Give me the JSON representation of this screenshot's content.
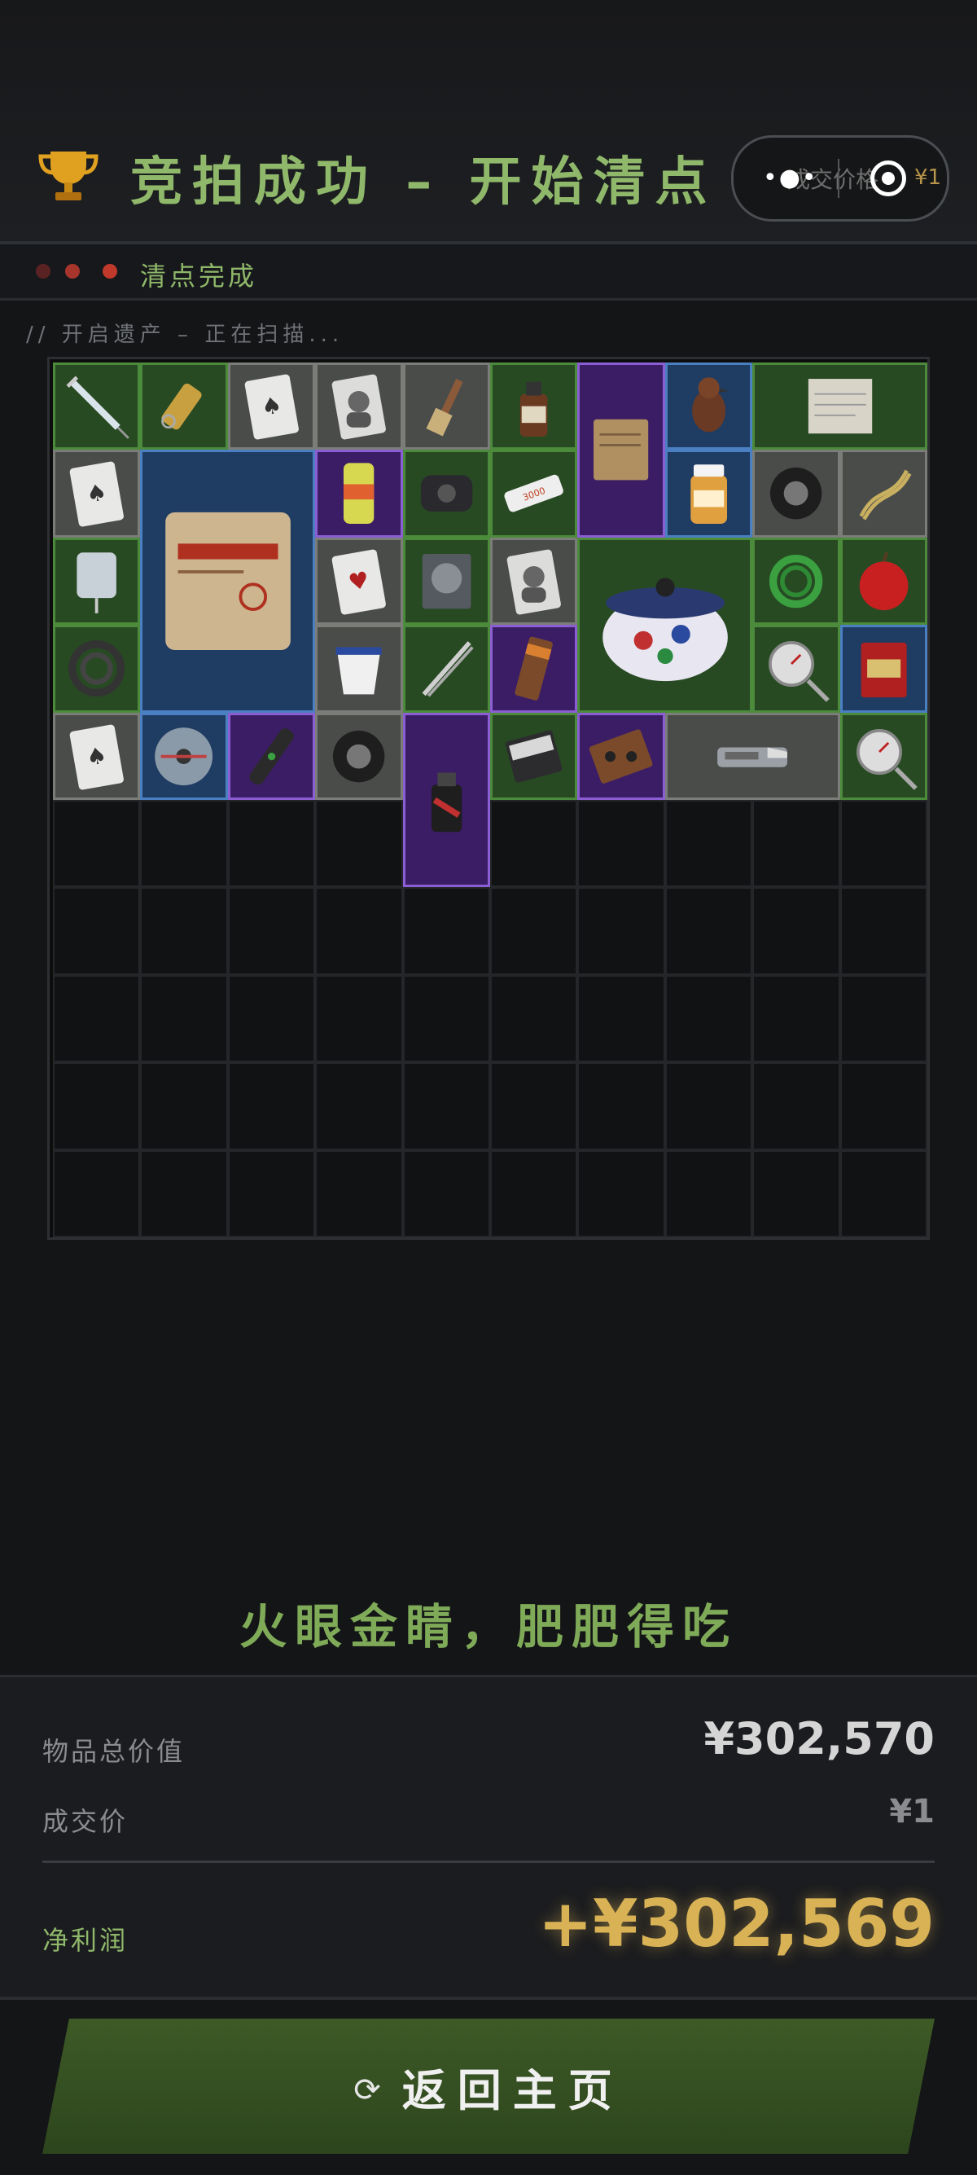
{
  "header": {
    "title": "竞拍成功 – 开始清点",
    "capsule": {
      "ghost_text": "成交价格",
      "ghost_price": "¥1"
    }
  },
  "status": {
    "text": "清点完成",
    "led_colors": [
      "#5a2222",
      "#a8352c",
      "#c0392b"
    ]
  },
  "scan_text": "// 开启遗产 – 正在扫描...",
  "grid": {
    "cols": 10,
    "rows": 10
  },
  "items": [
    {
      "name": "syringe-item",
      "rarity": "green",
      "c": 0,
      "r": 0,
      "w": 1,
      "h": 1,
      "icon": "syringe"
    },
    {
      "name": "bullet-keychain-item",
      "rarity": "green",
      "c": 1,
      "r": 0,
      "w": 1,
      "h": 1,
      "icon": "bullet"
    },
    {
      "name": "playing-card-item",
      "rarity": "gray",
      "c": 2,
      "r": 0,
      "w": 1,
      "h": 1,
      "icon": "card"
    },
    {
      "name": "portrait-card-item",
      "rarity": "gray",
      "c": 3,
      "r": 0,
      "w": 1,
      "h": 1,
      "icon": "portrait"
    },
    {
      "name": "brush-item",
      "rarity": "gray",
      "c": 4,
      "r": 0,
      "w": 1,
      "h": 1,
      "icon": "brush"
    },
    {
      "name": "medicine-bottle-item",
      "rarity": "green",
      "c": 5,
      "r": 0,
      "w": 1,
      "h": 1,
      "icon": "bottle"
    },
    {
      "name": "old-documents-item",
      "rarity": "purple",
      "c": 6,
      "r": 0,
      "w": 1,
      "h": 2,
      "icon": "docs"
    },
    {
      "name": "bird-figurine-item",
      "rarity": "blue",
      "c": 7,
      "r": 0,
      "w": 1,
      "h": 1,
      "icon": "bird"
    },
    {
      "name": "letter-item",
      "rarity": "green",
      "c": 8,
      "r": 0,
      "w": 2,
      "h": 1,
      "icon": "letter"
    },
    {
      "name": "card-spades-item",
      "rarity": "gray",
      "c": 0,
      "r": 1,
      "w": 1,
      "h": 1,
      "icon": "card"
    },
    {
      "name": "cement-bag-item",
      "rarity": "blue",
      "c": 1,
      "r": 1,
      "w": 2,
      "h": 3,
      "icon": "cement"
    },
    {
      "name": "energy-drink-item",
      "rarity": "purple",
      "c": 3,
      "r": 1,
      "w": 1,
      "h": 1,
      "icon": "can"
    },
    {
      "name": "power-bank-item",
      "rarity": "green",
      "c": 4,
      "r": 1,
      "w": 1,
      "h": 1,
      "icon": "device"
    },
    {
      "name": "battery-item",
      "rarity": "green",
      "c": 5,
      "r": 1,
      "w": 1,
      "h": 1,
      "icon": "battery"
    },
    {
      "name": "vitamin-bottle-item",
      "rarity": "blue",
      "c": 7,
      "r": 1,
      "w": 1,
      "h": 1,
      "icon": "pills"
    },
    {
      "name": "duct-tape-item",
      "rarity": "gray",
      "c": 8,
      "r": 1,
      "w": 1,
      "h": 1,
      "icon": "tape"
    },
    {
      "name": "rope-item",
      "rarity": "gray",
      "c": 9,
      "r": 1,
      "w": 1,
      "h": 1,
      "icon": "rope"
    },
    {
      "name": "iv-bag-item",
      "rarity": "green",
      "c": 0,
      "r": 2,
      "w": 1,
      "h": 1,
      "icon": "ivbag"
    },
    {
      "name": "card-hearts-item",
      "rarity": "gray",
      "c": 3,
      "r": 2,
      "w": 1,
      "h": 1,
      "icon": "cardred"
    },
    {
      "name": "hard-drive-item",
      "rarity": "green",
      "c": 4,
      "r": 2,
      "w": 1,
      "h": 1,
      "icon": "hdd"
    },
    {
      "name": "portrait-card-2-item",
      "rarity": "gray",
      "c": 5,
      "r": 2,
      "w": 1,
      "h": 1,
      "icon": "portrait"
    },
    {
      "name": "ceramic-pot-item",
      "rarity": "green",
      "c": 6,
      "r": 2,
      "w": 2,
      "h": 2,
      "icon": "pot"
    },
    {
      "name": "green-hose-item",
      "rarity": "green",
      "c": 8,
      "r": 2,
      "w": 1,
      "h": 1,
      "icon": "hose"
    },
    {
      "name": "apple-item",
      "rarity": "green",
      "c": 9,
      "r": 2,
      "w": 1,
      "h": 1,
      "icon": "apple"
    },
    {
      "name": "cable-coil-item",
      "rarity": "green",
      "c": 0,
      "r": 3,
      "w": 1,
      "h": 1,
      "icon": "coil"
    },
    {
      "name": "yogurt-cup-item",
      "rarity": "gray",
      "c": 3,
      "r": 3,
      "w": 1,
      "h": 1,
      "icon": "cup"
    },
    {
      "name": "tweezers-item",
      "rarity": "green",
      "c": 4,
      "r": 3,
      "w": 1,
      "h": 1,
      "icon": "tweezers"
    },
    {
      "name": "snack-bar-item",
      "rarity": "purple",
      "c": 5,
      "r": 3,
      "w": 1,
      "h": 1,
      "icon": "bar"
    },
    {
      "name": "gauge-item",
      "rarity": "green",
      "c": 8,
      "r": 3,
      "w": 1,
      "h": 1,
      "icon": "gauge"
    },
    {
      "name": "tea-tin-item",
      "rarity": "blue",
      "c": 9,
      "r": 3,
      "w": 1,
      "h": 1,
      "icon": "tin"
    },
    {
      "name": "card-spades-2-item",
      "rarity": "gray",
      "c": 0,
      "r": 4,
      "w": 1,
      "h": 1,
      "icon": "card"
    },
    {
      "name": "disc-item",
      "rarity": "blue",
      "c": 1,
      "r": 4,
      "w": 1,
      "h": 1,
      "icon": "disc"
    },
    {
      "name": "flashlight-item",
      "rarity": "purple",
      "c": 2,
      "r": 4,
      "w": 1,
      "h": 1,
      "icon": "flashlight"
    },
    {
      "name": "tape-roll-item",
      "rarity": "gray",
      "c": 3,
      "r": 4,
      "w": 1,
      "h": 1,
      "icon": "tape"
    },
    {
      "name": "spray-can-item",
      "rarity": "purple",
      "c": 4,
      "r": 4,
      "w": 1,
      "h": 2,
      "icon": "spray"
    },
    {
      "name": "notebook-item",
      "rarity": "green",
      "c": 5,
      "r": 4,
      "w": 1,
      "h": 1,
      "icon": "notebook"
    },
    {
      "name": "cassette-item",
      "rarity": "purple",
      "c": 6,
      "r": 4,
      "w": 1,
      "h": 1,
      "icon": "cassette"
    },
    {
      "name": "utility-knife-item",
      "rarity": "gray",
      "c": 7,
      "r": 4,
      "w": 2,
      "h": 1,
      "icon": "knife"
    },
    {
      "name": "gauge-2-item",
      "rarity": "green",
      "c": 9,
      "r": 4,
      "w": 1,
      "h": 1,
      "icon": "gauge"
    }
  ],
  "slogan": "火眼金睛，肥肥得吃",
  "summary": {
    "total_label": "物品总价值",
    "total_value": "¥302,570",
    "price_label": "成交价",
    "price_value": "¥1",
    "profit_label": "净利润",
    "profit_value": "+¥302,569"
  },
  "return_button": {
    "label": "返回主页",
    "icon": "refresh-icon"
  }
}
